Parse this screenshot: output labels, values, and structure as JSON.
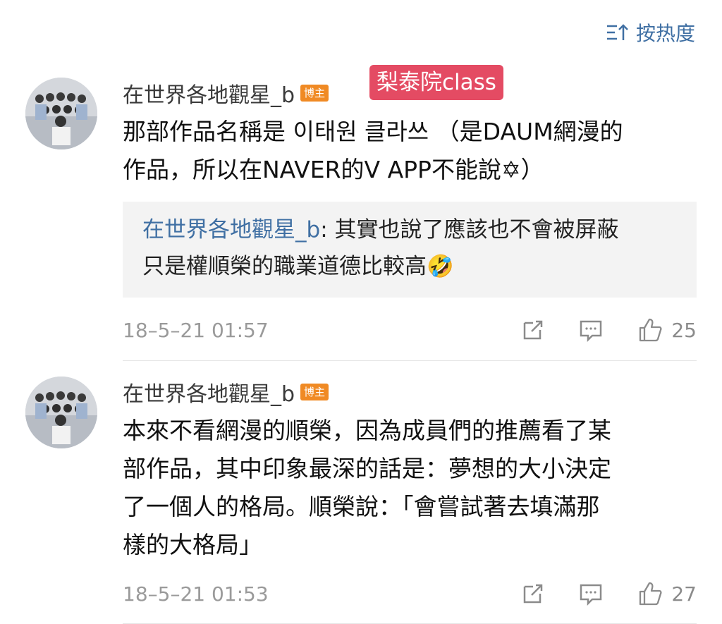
{
  "sort": {
    "label": "按热度",
    "icon": "sort-lines-icon"
  },
  "tag": {
    "label": "梨泰院class"
  },
  "comments": [
    {
      "author": "在世界各地觀星_b",
      "badge": "博主",
      "text_lines": [
        "那部作品名稱是 이태원 클라쓰 （是DAUM網漫的",
        "作品，所以在NAVER的V APP不能說✡︎）"
      ],
      "reply": {
        "author": "在世界各地觀星_b",
        "sep": ": ",
        "text": "其實也說了應該也不會被屏蔽",
        "text2": "只是權順榮的職業道德比較高🤣"
      },
      "time": "18–5–21 01:57",
      "likes": "25"
    },
    {
      "author": "在世界各地觀星_b",
      "badge": "博主",
      "text_lines": [
        "本來不看網漫的順榮，因為成員們的推薦看了某",
        "部作品，其中印象最深的話是：夢想的大小決定",
        "了一個人的格局。順榮說：「會嘗試著去填滿那",
        "樣的大格局」"
      ],
      "time": "18–5–21 01:53",
      "likes": "27"
    }
  ],
  "colors": {
    "link": "#3f6fa3",
    "badge": "#f08a24",
    "tag": "#e44b63"
  }
}
